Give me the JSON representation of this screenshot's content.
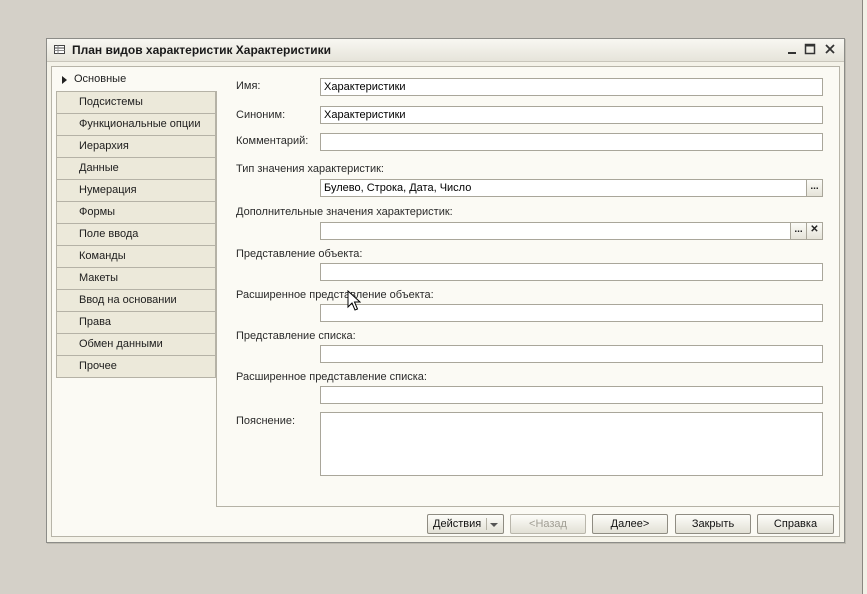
{
  "window": {
    "title": "План видов характеристик Характеристики"
  },
  "nav": {
    "items": [
      {
        "label": "Основные"
      },
      {
        "label": "Подсистемы"
      },
      {
        "label": "Функциональные опции"
      },
      {
        "label": "Иерархия"
      },
      {
        "label": "Данные"
      },
      {
        "label": "Нумерация"
      },
      {
        "label": "Формы"
      },
      {
        "label": "Поле ввода"
      },
      {
        "label": "Команды"
      },
      {
        "label": "Макеты"
      },
      {
        "label": "Ввод на основании"
      },
      {
        "label": "Права"
      },
      {
        "label": "Обмен данными"
      },
      {
        "label": "Прочее"
      }
    ]
  },
  "form": {
    "name_label": "Имя:",
    "name_value": "Характеристики",
    "synonym_label": "Синоним:",
    "synonym_value": "Характеристики",
    "comment_label": "Комментарий:",
    "comment_value": "",
    "value_type_label": "Тип значения характеристик:",
    "value_type_value": "Булево, Строка, Дата, Число",
    "extra_values_label": "Дополнительные значения характеристик:",
    "extra_values_value": "",
    "object_repr_label": "Представление объекта:",
    "ext_object_repr_label": "Расширенное представление объекта:",
    "list_repr_label": "Представление списка:",
    "ext_list_repr_label": "Расширенное представление списка:",
    "explanation_label": "Пояснение:",
    "ellipsis": "...",
    "clear": "✕"
  },
  "footer": {
    "actions": "Действия",
    "back": "<Назад",
    "next": "Далее>",
    "close": "Закрыть",
    "help": "Справка"
  }
}
